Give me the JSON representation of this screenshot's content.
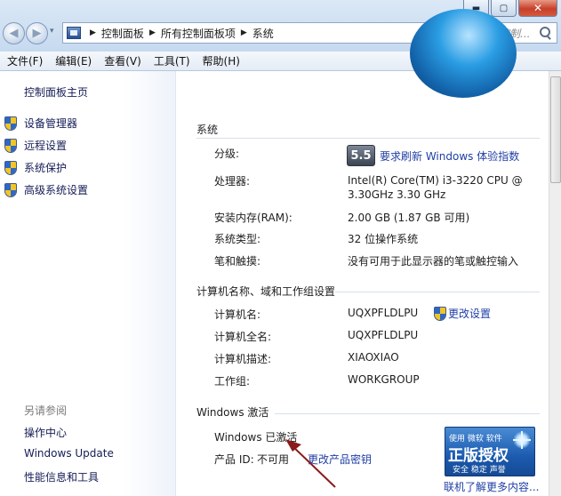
{
  "window": {
    "buttons": {
      "minimize": "▬",
      "maximize": "▢",
      "close": "✕"
    }
  },
  "nav": {
    "back": "◀",
    "forward": "▶",
    "history": "▾"
  },
  "address_bar": {
    "breadcrumbs": [
      "控制面板",
      "所有控制面板项",
      "系统"
    ],
    "separator": "▶",
    "dropdown": "▾"
  },
  "refresh": "⇆",
  "search": {
    "placeholder": "搜索控制..."
  },
  "menu": [
    "文件(F)",
    "编辑(E)",
    "查看(V)",
    "工具(T)",
    "帮助(H)"
  ],
  "sidebar": {
    "home": "控制面板主页",
    "tasks": [
      "设备管理器",
      "远程设置",
      "系统保护",
      "高级系统设置"
    ],
    "see_also": {
      "title": "另请参阅",
      "links": [
        "操作中心",
        "Windows Update",
        "性能信息和工具"
      ]
    }
  },
  "system": {
    "title": "系统",
    "rating": {
      "label": "分级:",
      "score": "5.5",
      "link": "要求刷新 Windows 体验指数"
    },
    "processor": {
      "label": "处理器:",
      "value": "Intel(R) Core(TM) i3-3220 CPU @ 3.30GHz   3.30 GHz"
    },
    "ram": {
      "label": "安装内存(RAM):",
      "value": "2.00 GB (1.87 GB 可用)"
    },
    "system_type": {
      "label": "系统类型:",
      "value": "32 位操作系统"
    },
    "pen_touch": {
      "label": "笔和触摸:",
      "value": "没有可用于此显示器的笔或触控输入"
    }
  },
  "computer": {
    "title": "计算机名称、域和工作组设置",
    "name": {
      "label": "计算机名:",
      "value": "UQXPFLDLPU"
    },
    "full_name": {
      "label": "计算机全名:",
      "value": "UQXPFLDLPU"
    },
    "description": {
      "label": "计算机描述:",
      "value": "XIAOXIAO"
    },
    "workgroup": {
      "label": "工作组:",
      "value": "WORKGROUP"
    },
    "change_settings": "更改设置"
  },
  "activation": {
    "title": "Windows 激活",
    "status": "Windows 已激活",
    "product_id_label": "产品 ID:",
    "product_id_value": "不可用",
    "change_key": "更改产品密钥",
    "badge": {
      "small": "使用 微软 软件",
      "big": "正版授权",
      "sub": "安全 稳定 声誉"
    },
    "learn_more": "联机了解更多内容..."
  },
  "colors": {
    "link": "#1f3fa5",
    "sidebar_link": "#151c55",
    "arrow": "#8b1a1a"
  }
}
